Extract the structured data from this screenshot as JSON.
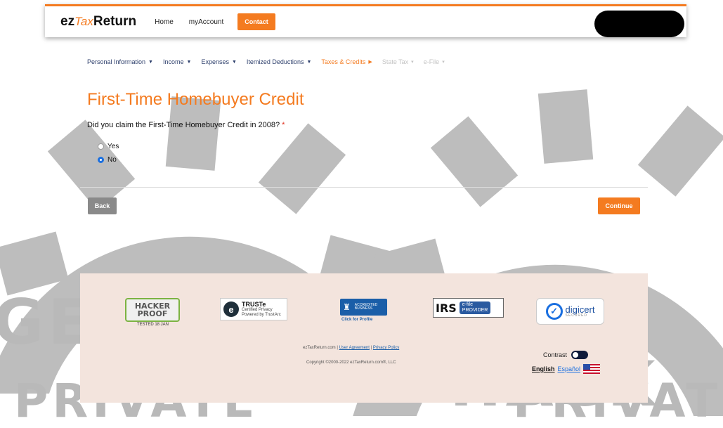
{
  "header": {
    "logo_prefix": "ez",
    "logo_tax": "Tax",
    "logo_suffix": "Return",
    "nav": [
      "Home",
      "myAccount"
    ],
    "contact_label": "Contact"
  },
  "steps": [
    {
      "label": "Personal Information",
      "state": "done"
    },
    {
      "label": "Income",
      "state": "done"
    },
    {
      "label": "Expenses",
      "state": "done"
    },
    {
      "label": "Itemized Deductions",
      "state": "done"
    },
    {
      "label": "Taxes & Credits",
      "state": "active"
    },
    {
      "label": "State Tax",
      "state": "disabled"
    },
    {
      "label": "e-File",
      "state": "disabled"
    }
  ],
  "page": {
    "title": "First-Time Homebuyer Credit",
    "question": "Did you claim the First-Time Homebuyer Credit in 2008?",
    "required_mark": "*",
    "options": [
      {
        "label": "Yes",
        "selected": false
      },
      {
        "label": "No",
        "selected": true
      }
    ],
    "back_label": "Back",
    "continue_label": "Continue"
  },
  "footer": {
    "hacker_title": "HACKER",
    "hacker_sub": "PROOF",
    "hacker_tested": "TESTED 18 JAN",
    "truste_title": "TRUSTe",
    "truste_line1": "Certified Privacy",
    "truste_line2": "Powered by TrustArc",
    "bbb_line1": "ACCREDITED",
    "bbb_line2": "BUSINESS",
    "bbb_caption": "Click for Profile",
    "irs_text": "IRS",
    "irs_badge1": "e-file",
    "irs_badge2": "PROVIDER",
    "digicert_text": "digicert",
    "digicert_sub": "SECURED",
    "link_site": "ezTaxReturn.com",
    "link_agreement": "User Agreement",
    "link_privacy": "Privacy Policy",
    "copyright": "Copyright ©2000-2022 ezTaxReturn.com®, LLC",
    "contrast_label": "Contrast",
    "lang_english": "English",
    "lang_spanish": "Español"
  },
  "watermark": {
    "line1": "GET HACK",
    "line2": "PRIVATE"
  },
  "colors": {
    "accent": "#f47b20",
    "nav_text": "#2c3e6b",
    "footer_bg": "#f3e4dd",
    "watermark": "#b9b9b9"
  }
}
